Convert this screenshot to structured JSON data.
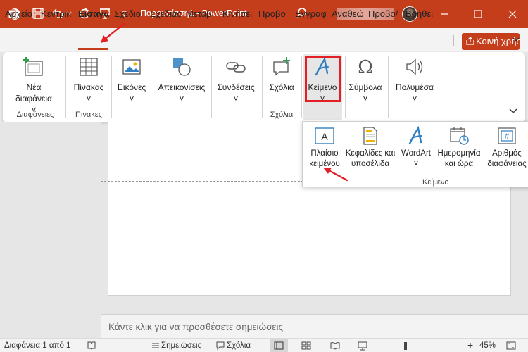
{
  "window": {
    "title": "Παρουσίαση1 - PowerPoint"
  },
  "tabs": [
    "Αρχείο",
    "Κεντρικ",
    "Εισαγω",
    "Σχέδιο",
    "Σχεδιασ",
    "Μεταβ",
    "Κινήσει",
    "Προβο",
    "Εγγραφ",
    "Αναθεώ",
    "Προβο/",
    "Βοήθει"
  ],
  "active_tab": "Εισαγω",
  "share_label": "Κοινή χρήση",
  "ribbon": {
    "new_slide": "Νέα",
    "new_slide_2": "διαφάνεια",
    "slides_group": "Διαφάνειες",
    "table": "Πίνακας",
    "tables_group": "Πίνακες",
    "images": "Εικόνες",
    "illustrations": "Απεικονίσεις",
    "links": "Συνδέσεις",
    "comment": "Σχόλια",
    "comments_group": "Σχόλια",
    "text": "Κείμενο",
    "symbols": "Σύμβολα",
    "media": "Πολυμέσα"
  },
  "dropdown": {
    "textbox_1": "Πλαίσιο",
    "textbox_2": "κειμένου",
    "header_1": "Κεφαλίδες και",
    "header_2": "υποσέλιδα",
    "wordart": "WordArt",
    "datetime_1": "Ημερομηνία",
    "datetime_2": "και ώρα",
    "slidenum_1": "Αριθμός",
    "slidenum_2": "διαφάνειας",
    "group_label": "Κείμενο"
  },
  "notes_placeholder": "Κάντε κλικ για να προσθέσετε σημειώσεις",
  "status": {
    "slide_info": "Διαφάνεια 1 από 1",
    "notes": "Σημειώσεις",
    "comments": "Σχόλια",
    "zoom": "45%"
  },
  "colors": {
    "accent": "#c43e1c",
    "highlight_box": "#e31e24",
    "wordart_blue": "#2f7fc1"
  }
}
